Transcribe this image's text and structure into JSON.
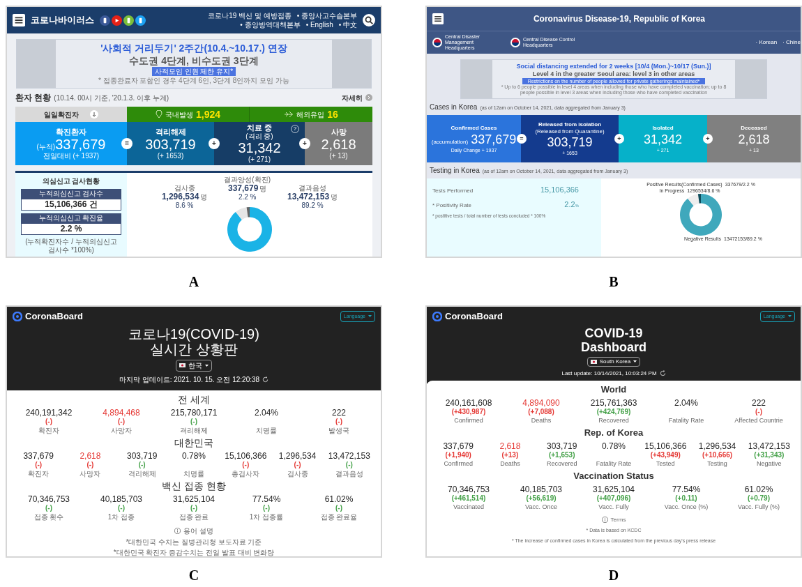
{
  "panel_a": {
    "kind": "kr_gov",
    "figure_label": "A",
    "header": {
      "title": "코로나바이러스",
      "nav": [
        "코로나19 백신 및 예방접종",
        "• 중앙사고수습본부",
        "• 중앙방역대책본부",
        "• English",
        "• 中文"
      ]
    },
    "banner": {
      "line1": "'사회적 거리두기' 2주간(10.4.~10.17.) 연장",
      "line2": "수도권 4단계, 비수도권 3단계",
      "tag": "사적모임 인원 제한 유지*",
      "note": "* 접종완료자 포함인 경우 4단계 6인, 3단계 8인까지 모임 가능"
    },
    "status": {
      "title": "환자 현황",
      "subtitle": "(10.14. 00시 기준, '20.1.3. 이후 누계)",
      "more": "자세히"
    },
    "daily": {
      "label": "일일확진자",
      "items": [
        {
          "label": "국내발생",
          "value": "1,924"
        },
        {
          "label": "해외유입",
          "value": "16"
        }
      ]
    },
    "cards": [
      {
        "title": "확진환자",
        "prefix": "(누적)",
        "value": "337,679",
        "change": "전일대비 (+ 1937)",
        "op": "=",
        "color": "#0a9cf2"
      },
      {
        "title": "격리해제",
        "value": "303,719",
        "change": "(+ 1653)",
        "op": "+",
        "color": "#0c6598"
      },
      {
        "title": "치료 중",
        "subtitle": "(격리 중)",
        "hint": "?",
        "value": "31,342",
        "change": "(+ 271)",
        "op": "+",
        "color": "#163d66"
      },
      {
        "title": "사망",
        "value": "2,618",
        "change": "(+ 13)",
        "color": "#7b7b7b"
      }
    ],
    "testing": {
      "title": "의심신고 검사현황",
      "boxes": [
        {
          "label": "누적의심신고 검사수",
          "value": "15,106,366 건"
        },
        {
          "label": "누적의심신고 확진율",
          "value": "2.2 %"
        }
      ],
      "note": "(누적확진자수 / 누적의심신고 검사수 *100%)"
    },
    "chart_data": {
      "type": "donut",
      "categories": [
        "결과양성(확진)",
        "검사중",
        "결과음성"
      ],
      "values": [
        2.2,
        8.6,
        89.2
      ]
    },
    "slice_labels": [
      {
        "value": "337,679",
        "unit": "명",
        "percent": "2.2 %"
      },
      {
        "value": "1,296,534",
        "unit": "명",
        "percent": "8.6 %"
      },
      {
        "value": "13,472,153",
        "unit": "명",
        "percent": "89.2 %"
      }
    ]
  },
  "panel_b": {
    "kind": "en_gov",
    "figure_label": "B",
    "header": {
      "title": "Coronavirus Disease-19, Republic of Korea",
      "agencies": [
        "Central Disaster Management Headquarters",
        "Central Disease Control Headquarters"
      ],
      "languages": [
        "· Korean",
        "· Chine"
      ]
    },
    "banner": {
      "line1": "Social distancing extended for 2 weeks [10/4 (Mon.)~10/17 (Sun.)]",
      "line2": "Level 4 in the greater Seoul area: level 3 in other areas",
      "tag": "Restrictions on the number of people allowed for private gatherings maintained*",
      "note": "* Up to 6 people possible in level 4 areas when including those who have completed vaccination; up to 8 people possible in level 3 areas when including those who have completed vaccination"
    },
    "cases_heading": {
      "title": "Cases in Korea",
      "subtitle": "(as of 12am on October 14, 2021, data aggregated from January 3)"
    },
    "cards": [
      {
        "title": "Confirmed Cases",
        "prefix": "(accumulation)",
        "value": "337,679",
        "change": "Daily Change + 1937",
        "op": "=",
        "color": "#2b74dc"
      },
      {
        "title": "Released from isolation",
        "subtitle": "(Released from Quarantine)",
        "value": "303,719",
        "change": "+ 1653",
        "op": "+",
        "color": "#143b8e"
      },
      {
        "title": "Isolated",
        "value": "31,342",
        "change": "+ 271",
        "op": "+",
        "color": "#06b1c9"
      },
      {
        "title": "Deceased",
        "value": "2,618",
        "change": "+ 13",
        "color": "#808080"
      }
    ],
    "testing_heading": {
      "title": "Testing in Korea",
      "subtitle": "(as of 12am on October 14, 2021, data aggregated from January 3)"
    },
    "testing": {
      "rows": [
        {
          "label": "Tests Performed",
          "value": "15,106,366"
        },
        {
          "label": "* Positivity Rate",
          "value": "2.2",
          "unit": "%"
        }
      ],
      "note": "* postitive tests / total number of tests concluded * 100%"
    },
    "chart_data": {
      "type": "donut",
      "categories": [
        "Positive Results(Confirmed Cases)",
        "In Progress",
        "Negative Results"
      ],
      "values": [
        2.2,
        8.6,
        89.2
      ]
    },
    "slice_labels": [
      "337679/2.2 %",
      "1296534/8.6 %",
      "13472153/89.2 %"
    ]
  },
  "panel_c": {
    "kind": "coronaboard_ko",
    "figure_label": "C",
    "brand": "CoronaBoard",
    "language": "Language",
    "title": [
      "코로나19(COVID-19)",
      "실시간 상황판"
    ],
    "country": "한국",
    "update": "마지막 업데이트: 2021. 10. 15. 오전 12:20:38",
    "sections": [
      {
        "title": "전 세계",
        "stats": [
          {
            "value": "240,191,342",
            "delta": "(-)",
            "color": "#e53935",
            "label": "확진자",
            "alert": false
          },
          {
            "value": "4,894,468",
            "delta": "(-)",
            "color": "#e53935",
            "label": "사망자",
            "alert": true
          },
          {
            "value": "215,780,171",
            "delta": "(-)",
            "color": "#43a047",
            "label": "격리해제",
            "alert": false
          },
          {
            "value": "2.04%",
            "label": "치명률",
            "alert": false
          },
          {
            "value": "222",
            "delta": "(-)",
            "color": "#e53935",
            "label": "발생국",
            "alert": false
          }
        ]
      },
      {
        "title": "대한민국",
        "stats": [
          {
            "value": "337,679",
            "delta": "(-)",
            "color": "#e53935",
            "label": "확진자",
            "alert": false
          },
          {
            "value": "2,618",
            "delta": "(-)",
            "color": "#e53935",
            "label": "사망자",
            "alert": true
          },
          {
            "value": "303,719",
            "delta": "(-)",
            "color": "#43a047",
            "label": "격리해제",
            "alert": false
          },
          {
            "value": "0.78%",
            "label": "치명률",
            "alert": false
          },
          {
            "value": "15,106,366",
            "delta": "(-)",
            "color": "#e53935",
            "label": "총검사자",
            "alert": false
          },
          {
            "value": "1,296,534",
            "delta": "(-)",
            "color": "#e53935",
            "label": "검사중",
            "alert": false
          },
          {
            "value": "13,472,153",
            "delta": "(-)",
            "color": "#43a047",
            "label": "결과음성",
            "alert": false
          }
        ]
      },
      {
        "title": "백신 접종 현황",
        "stats": [
          {
            "value": "70,346,753",
            "delta": "(-)",
            "color": "#43a047",
            "label": "접종 횟수",
            "alert": false
          },
          {
            "value": "40,185,703",
            "delta": "(-)",
            "color": "#43a047",
            "label": "1차 접종",
            "alert": false
          },
          {
            "value": "31,625,104",
            "delta": "(-)",
            "color": "#43a047",
            "label": "접종 완료",
            "alert": false
          },
          {
            "value": "77.54%",
            "delta": "(-)",
            "color": "#43a047",
            "label": "1차 접종률",
            "alert": false
          },
          {
            "value": "61.02%",
            "delta": "(-)",
            "color": "#43a047",
            "label": "접종 완료율",
            "alert": false
          }
        ]
      }
    ],
    "terms": "용어 설명",
    "notes": [
      "*대한민국 수치는 질병관리청 보도자료 기준",
      "*대한민국 확진자 증감수치는 전일 발표 대비 변화량"
    ]
  },
  "panel_d": {
    "kind": "coronaboard_en",
    "figure_label": "D",
    "brand": "CoronaBoard",
    "language": "Language",
    "title": [
      "COVID-19",
      "Dashboard"
    ],
    "country": "South Korea",
    "update": "Last update: 10/14/2021, 10:03:24 PM",
    "sections": [
      {
        "title": "World",
        "stats": [
          {
            "value": "240,161,608",
            "delta": "(+430,987)",
            "color": "#e53935",
            "label": "Confirmed",
            "alert": false
          },
          {
            "value": "4,894,090",
            "delta": "(+7,088)",
            "color": "#e53935",
            "label": "Deaths",
            "alert": true
          },
          {
            "value": "215,761,363",
            "delta": "(+424,769)",
            "color": "#43a047",
            "label": "Recovered",
            "alert": false
          },
          {
            "value": "2.04%",
            "label": "Fatality Rate",
            "alert": false
          },
          {
            "value": "222",
            "delta": "(-)",
            "color": "#e53935",
            "label": "Affected Countrie",
            "alert": false
          }
        ]
      },
      {
        "title": "Rep. of Korea",
        "stats": [
          {
            "value": "337,679",
            "delta": "(+1,940)",
            "color": "#e53935",
            "label": "Confirmed",
            "alert": false
          },
          {
            "value": "2,618",
            "delta": "(+13)",
            "color": "#e53935",
            "label": "Deaths",
            "alert": true
          },
          {
            "value": "303,719",
            "delta": "(+1,653)",
            "color": "#43a047",
            "label": "Recovered",
            "alert": false
          },
          {
            "value": "0.78%",
            "label": "Fatality Rate",
            "alert": false
          },
          {
            "value": "15,106,366",
            "delta": "(+43,949)",
            "color": "#e53935",
            "label": "Tested",
            "alert": false
          },
          {
            "value": "1,296,534",
            "delta": "(+10,666)",
            "color": "#e53935",
            "label": "Testing",
            "alert": false
          },
          {
            "value": "13,472,153",
            "delta": "(+31,343)",
            "color": "#43a047",
            "label": "Negative",
            "alert": false
          }
        ]
      },
      {
        "title": "Vaccination Status",
        "stats": [
          {
            "value": "70,346,753",
            "delta": "(+461,514)",
            "color": "#43a047",
            "label": "Vaccinated",
            "alert": false
          },
          {
            "value": "40,185,703",
            "delta": "(+56,619)",
            "color": "#43a047",
            "label": "Vacc. Once",
            "alert": false
          },
          {
            "value": "31,625,104",
            "delta": "(+407,096)",
            "color": "#43a047",
            "label": "Vacc. Fully",
            "alert": false
          },
          {
            "value": "77.54%",
            "delta": "(+0.11)",
            "color": "#43a047",
            "label": "Vacc. Once (%)",
            "alert": false
          },
          {
            "value": "61.02%",
            "delta": "(+0.79)",
            "color": "#43a047",
            "label": "Vacc. Fully (%)",
            "alert": false
          }
        ]
      }
    ],
    "terms": "Terms",
    "notes": [
      "* Data is based on KCDC",
      "* The increase of confirmed cases in Korea is calculated from the previous day's press release"
    ]
  }
}
